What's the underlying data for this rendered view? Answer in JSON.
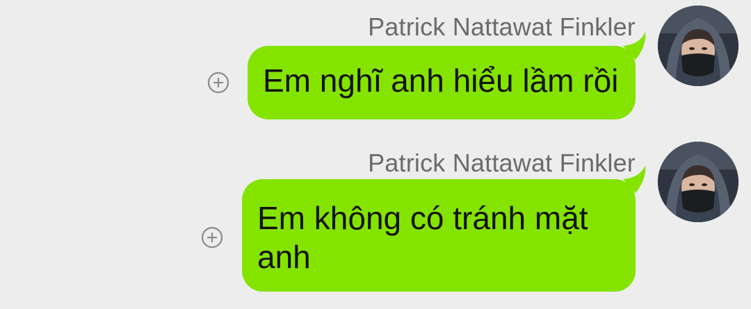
{
  "messages": [
    {
      "sender": "Patrick Nattawat Finkler",
      "text": "Em nghĩ anh hiểu lầm rồi",
      "bubble_color": "#84e400",
      "action_icon": "add-circle-icon",
      "avatar_icon": "avatar-hooded-masked-person"
    },
    {
      "sender": "Patrick Nattawat Finkler",
      "text": "Em không có tránh mặt anh",
      "bubble_color": "#84e400",
      "action_icon": "add-circle-icon",
      "avatar_icon": "avatar-hooded-masked-person"
    }
  ],
  "theme": {
    "background": "#ededed",
    "sender_color": "#6b6b6b",
    "text_color": "#111111"
  }
}
